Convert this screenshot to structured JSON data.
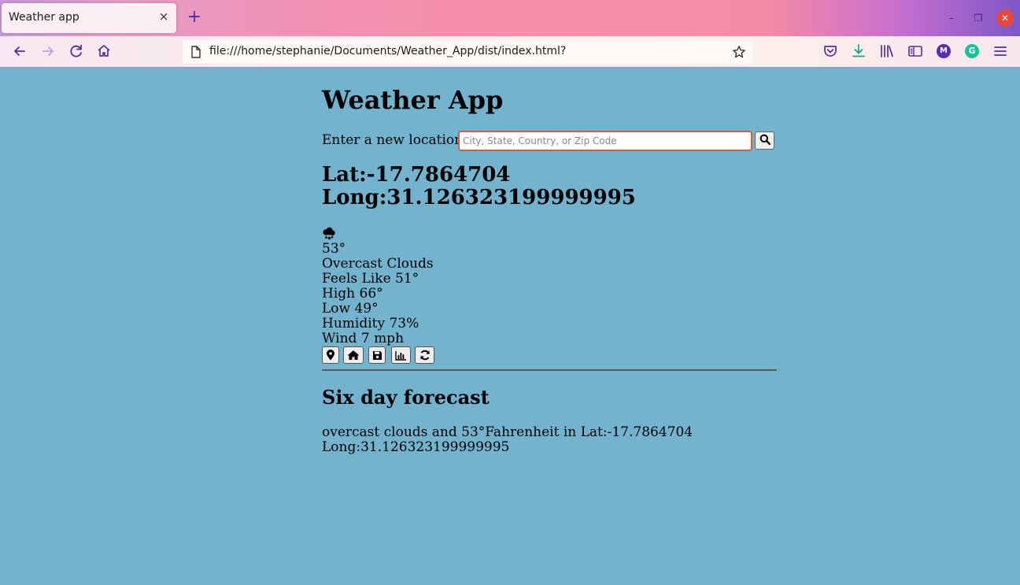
{
  "browser": {
    "tab_title": "Weather app",
    "tab_close_glyph": "×",
    "new_tab_glyph": "+",
    "url": "file:///home/stephanie/Documents/Weather_App/dist/index.html?",
    "window_controls": {
      "minimize": "–",
      "maximize": "❐",
      "close": "✕"
    },
    "extensions": {
      "m_avatar": "M",
      "g_avatar": "G"
    }
  },
  "page": {
    "title": "Weather App",
    "search": {
      "label": "Enter a new location",
      "placeholder": "City, State, Country, or Zip Code",
      "value": ""
    },
    "location": {
      "lat": "Lat:-17.7864704",
      "long": "Long:31.126323199999995"
    },
    "current": {
      "icon": "cloud-rain-icon",
      "temperature": "53°",
      "condition": "Overcast Clouds",
      "feels_like": "Feels Like 51°",
      "high": "High 66°",
      "low": "Low 49°",
      "humidity": "Humidity 73%",
      "wind": "Wind 7 mph"
    },
    "actions": [
      "map-marker-icon",
      "home-icon",
      "save-icon",
      "chart-icon",
      "refresh-icon"
    ],
    "forecast": {
      "heading": "Six day forecast",
      "summary": "overcast clouds and 53°Fahrenheit in Lat:-17.7864704 Long:31.126323199999995"
    }
  },
  "colors": {
    "page_background": "#74b3cd",
    "input_focus_border": "#d4612f",
    "browser_accent": "#5a2ca0"
  }
}
